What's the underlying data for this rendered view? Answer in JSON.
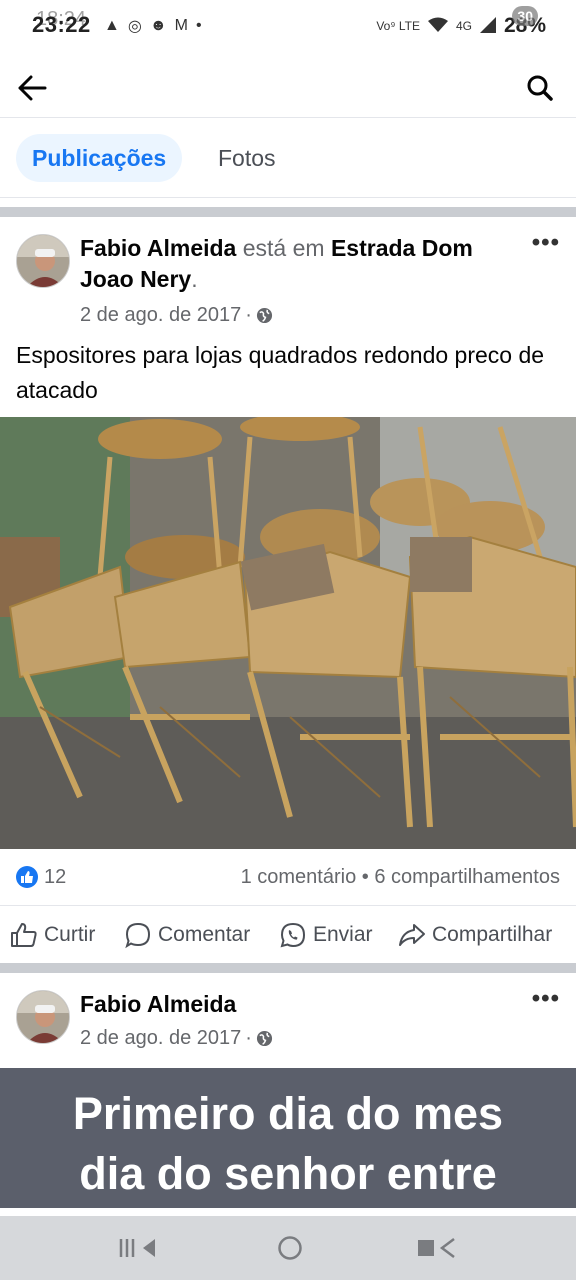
{
  "status_bar": {
    "time": "23:22",
    "time_ghost": "18:24",
    "network_label": "Vo⁹ LTE",
    "network_gen": "4G",
    "battery": "28%",
    "battery_ghost": "30"
  },
  "header": {
    "back_icon": "arrow-left-icon",
    "search_icon": "search-icon"
  },
  "tabs": [
    {
      "label": "Publicações",
      "active": true
    },
    {
      "label": "Fotos",
      "active": false
    }
  ],
  "post1": {
    "author": "Fabio Almeida",
    "verb": " está em ",
    "location": "Estrada Dom Joao Nery",
    "location_suffix": ".",
    "date": "2 de ago. de 2017",
    "meta_sep": " · ",
    "privacy_icon": "globe-icon",
    "text": "Espositores para lojas quadrados redondo preco de atacado",
    "likes": "12",
    "comments": "1 comentário",
    "counts_sep": " • ",
    "shares": "6 compartilhamentos",
    "actions": {
      "like": "Curtir",
      "comment": "Comentar",
      "send": "Enviar",
      "share": "Compartilhar"
    }
  },
  "post2": {
    "author": "Fabio Almeida",
    "date": "2 de ago. de 2017",
    "meta_sep": " · ",
    "banner_line1": "Primeiro dia do mes",
    "banner_line2": "dia do senhor entre"
  },
  "colors": {
    "accent": "#1877f2",
    "tab_active_bg": "#ebf5ff",
    "separator": "#c9ccd1",
    "banner_bg": "#5b5f6b"
  }
}
